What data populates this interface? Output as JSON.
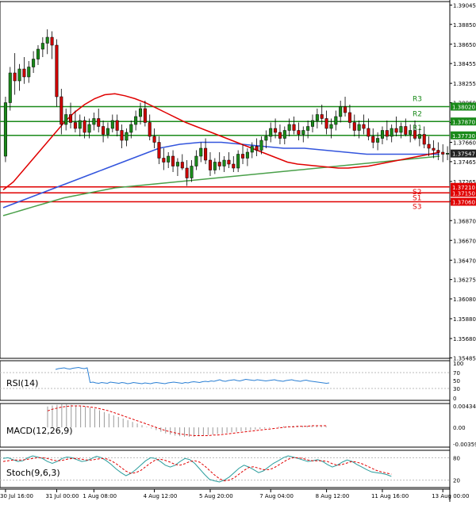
{
  "colors": {
    "up": "#1a8a1a",
    "down": "#cc0000",
    "ma_fast": "#e00000",
    "ma_mid": "#3355dd",
    "ma_slow": "#4aa04a",
    "resistance": "#1a8a1a",
    "support": "#e00000",
    "rsi": "#2a7fd4",
    "macd_hist": "#999999",
    "macd_signal": "#e00000",
    "stoch_main": "#2a9d9d",
    "stoch_signal": "#e00000",
    "price_tag": "#222222"
  },
  "chart_data": [
    {
      "type": "candlestick",
      "ylim": [
        1.3548,
        1.3908
      ],
      "ticks": [
        "1.39045",
        "1.38850",
        "1.38650",
        "1.38455",
        "1.38255",
        "1.38060",
        "1.37860",
        "1.37660",
        "1.37465",
        "1.37265",
        "1.37065",
        "1.36870",
        "1.36670",
        "1.36470",
        "1.36275",
        "1.36080",
        "1.35880",
        "1.35680",
        "1.35485"
      ],
      "current_price": "1.37547",
      "current_value": 1.37547,
      "x_ticks": [
        "30 Jul 16:00",
        "31 Jul 00:00",
        "1 Aug 08:00",
        "4 Aug 12:00",
        "5 Aug 20:00",
        "7 Aug 04:00",
        "8 Aug 12:00",
        "11 Aug 16:00",
        "13 Aug 00:00"
      ],
      "x_tick_index": [
        0,
        11,
        19,
        32,
        44,
        57,
        69,
        81,
        94
      ],
      "levels": [
        {
          "name": "R3",
          "label": "1.38020",
          "value": 1.3802,
          "kind": "resistance"
        },
        {
          "name": "R2",
          "label": "1.37870",
          "value": 1.3787,
          "kind": "resistance"
        },
        {
          "name": "R1",
          "label": "1.37730",
          "value": 1.3773,
          "kind": "resistance"
        },
        {
          "name": "S1",
          "label": "1.37150",
          "value": 1.3715,
          "kind": "support"
        },
        {
          "name": "S2",
          "label": "1.37210",
          "value": 1.3721,
          "kind": "support"
        },
        {
          "name": "S3",
          "label": "1.37060",
          "value": 1.3706,
          "kind": "support"
        }
      ],
      "candles": [
        [
          1.3752,
          1.3812,
          1.3746,
          1.3806
        ],
        [
          1.3806,
          1.3842,
          1.3798,
          1.3836
        ],
        [
          1.3836,
          1.3856,
          1.3814,
          1.3828
        ],
        [
          1.3828,
          1.3845,
          1.3818,
          1.384
        ],
        [
          1.384,
          1.3852,
          1.3825,
          1.3832
        ],
        [
          1.3832,
          1.3848,
          1.3826,
          1.3842
        ],
        [
          1.3842,
          1.3858,
          1.3836,
          1.385
        ],
        [
          1.385,
          1.3864,
          1.3844,
          1.386
        ],
        [
          1.386,
          1.3872,
          1.3852,
          1.3866
        ],
        [
          1.3866,
          1.388,
          1.3855,
          1.3872
        ],
        [
          1.3872,
          1.3878,
          1.385,
          1.3864
        ],
        [
          1.3864,
          1.387,
          1.3802,
          1.3812
        ],
        [
          1.3812,
          1.382,
          1.3774,
          1.3784
        ],
        [
          1.3784,
          1.38,
          1.3778,
          1.3794
        ],
        [
          1.3794,
          1.3806,
          1.378,
          1.3786
        ],
        [
          1.3786,
          1.3798,
          1.3776,
          1.378
        ],
        [
          1.378,
          1.3794,
          1.3772,
          1.3788
        ],
        [
          1.3788,
          1.3792,
          1.377,
          1.3776
        ],
        [
          1.3776,
          1.379,
          1.377,
          1.3784
        ],
        [
          1.3784,
          1.3796,
          1.3778,
          1.379
        ],
        [
          1.379,
          1.38,
          1.3776,
          1.3782
        ],
        [
          1.3782,
          1.3788,
          1.3766,
          1.3774
        ],
        [
          1.3774,
          1.3786,
          1.377,
          1.378
        ],
        [
          1.378,
          1.3794,
          1.3776,
          1.3788
        ],
        [
          1.3788,
          1.3794,
          1.3772,
          1.3778
        ],
        [
          1.3778,
          1.3784,
          1.376,
          1.3768
        ],
        [
          1.3768,
          1.378,
          1.3762,
          1.3776
        ],
        [
          1.3776,
          1.3788,
          1.377,
          1.3784
        ],
        [
          1.3784,
          1.3798,
          1.3778,
          1.3792
        ],
        [
          1.3792,
          1.3806,
          1.3784,
          1.38
        ],
        [
          1.38,
          1.3808,
          1.3782,
          1.3786
        ],
        [
          1.3786,
          1.3794,
          1.3768,
          1.3772
        ],
        [
          1.3772,
          1.378,
          1.376,
          1.3766
        ],
        [
          1.3766,
          1.3772,
          1.3744,
          1.375
        ],
        [
          1.375,
          1.376,
          1.3738,
          1.3746
        ],
        [
          1.3746,
          1.3756,
          1.374,
          1.3752
        ],
        [
          1.3752,
          1.3758,
          1.3736,
          1.3742
        ],
        [
          1.3742,
          1.375,
          1.3732,
          1.3746
        ],
        [
          1.3746,
          1.3754,
          1.3738,
          1.374
        ],
        [
          1.374,
          1.3748,
          1.3722,
          1.373
        ],
        [
          1.373,
          1.3748,
          1.3726,
          1.3742
        ],
        [
          1.3742,
          1.3758,
          1.3738,
          1.3752
        ],
        [
          1.3752,
          1.3766,
          1.3746,
          1.376
        ],
        [
          1.376,
          1.377,
          1.3744,
          1.3748
        ],
        [
          1.3748,
          1.3756,
          1.3732,
          1.3738
        ],
        [
          1.3738,
          1.375,
          1.3734,
          1.3746
        ],
        [
          1.3746,
          1.3756,
          1.3738,
          1.3742
        ],
        [
          1.3742,
          1.3752,
          1.3736,
          1.3748
        ],
        [
          1.3748,
          1.3756,
          1.374,
          1.3744
        ],
        [
          1.3744,
          1.3752,
          1.3736,
          1.374
        ],
        [
          1.374,
          1.3758,
          1.3736,
          1.3754
        ],
        [
          1.3754,
          1.3764,
          1.3744,
          1.375
        ],
        [
          1.375,
          1.376,
          1.3742,
          1.3756
        ],
        [
          1.3756,
          1.3766,
          1.375,
          1.3762
        ],
        [
          1.3762,
          1.377,
          1.3752,
          1.3758
        ],
        [
          1.3758,
          1.3772,
          1.3754,
          1.3768
        ],
        [
          1.3768,
          1.3778,
          1.376,
          1.3772
        ],
        [
          1.3772,
          1.3786,
          1.3766,
          1.378
        ],
        [
          1.378,
          1.379,
          1.377,
          1.3776
        ],
        [
          1.3776,
          1.3784,
          1.3764,
          1.377
        ],
        [
          1.377,
          1.3782,
          1.3764,
          1.3778
        ],
        [
          1.3778,
          1.379,
          1.3772,
          1.3784
        ],
        [
          1.3784,
          1.3792,
          1.3774,
          1.3778
        ],
        [
          1.3778,
          1.3786,
          1.3768,
          1.3774
        ],
        [
          1.3774,
          1.3782,
          1.3766,
          1.3778
        ],
        [
          1.3778,
          1.3788,
          1.377,
          1.3782
        ],
        [
          1.3782,
          1.3794,
          1.3776,
          1.3788
        ],
        [
          1.3788,
          1.38,
          1.378,
          1.3794
        ],
        [
          1.3794,
          1.3804,
          1.3784,
          1.379
        ],
        [
          1.379,
          1.3798,
          1.3774,
          1.378
        ],
        [
          1.378,
          1.379,
          1.377,
          1.3784
        ],
        [
          1.3784,
          1.3798,
          1.3778,
          1.3792
        ],
        [
          1.3792,
          1.3808,
          1.3786,
          1.3802
        ],
        [
          1.3802,
          1.3812,
          1.3792,
          1.3796
        ],
        [
          1.3796,
          1.3804,
          1.378,
          1.3786
        ],
        [
          1.3786,
          1.3794,
          1.3772,
          1.3778
        ],
        [
          1.3778,
          1.3788,
          1.377,
          1.3784
        ],
        [
          1.3784,
          1.3794,
          1.3774,
          1.378
        ],
        [
          1.378,
          1.379,
          1.3768,
          1.3772
        ],
        [
          1.3772,
          1.378,
          1.376,
          1.3766
        ],
        [
          1.3766,
          1.3776,
          1.3758,
          1.377
        ],
        [
          1.377,
          1.3782,
          1.3764,
          1.3778
        ],
        [
          1.3778,
          1.3788,
          1.3768,
          1.3772
        ],
        [
          1.3772,
          1.3784,
          1.3766,
          1.378
        ],
        [
          1.378,
          1.3792,
          1.3772,
          1.3776
        ],
        [
          1.3776,
          1.3786,
          1.377,
          1.3782
        ],
        [
          1.3782,
          1.379,
          1.3772,
          1.3774
        ],
        [
          1.3774,
          1.3784,
          1.3766,
          1.3778
        ],
        [
          1.3778,
          1.3788,
          1.3768,
          1.377
        ],
        [
          1.377,
          1.378,
          1.3762,
          1.3774
        ],
        [
          1.3774,
          1.3782,
          1.376,
          1.3764
        ],
        [
          1.3764,
          1.3772,
          1.3752,
          1.376
        ],
        [
          1.376,
          1.3768,
          1.375,
          1.3758
        ],
        [
          1.3758,
          1.3766,
          1.3748,
          1.3756
        ],
        [
          1.3756,
          1.3764,
          1.3746,
          1.3754
        ],
        [
          1.3754,
          1.3762,
          1.3748,
          1.3755
        ]
      ],
      "ma_fast": [
        1.3718,
        1.3726,
        1.3738,
        1.375,
        1.3762,
        1.3774,
        1.3786,
        1.3796,
        1.3804,
        1.381,
        1.3814,
        1.3815,
        1.3813,
        1.381,
        1.3806,
        1.3801,
        1.3796,
        1.3791,
        1.3786,
        1.3782,
        1.3778,
        1.3774,
        1.377,
        1.3766,
        1.3762,
        1.3758,
        1.3754,
        1.375,
        1.3746,
        1.3744,
        1.3743,
        1.3742,
        1.3741,
        1.374,
        1.374,
        1.3741,
        1.3742,
        1.3744,
        1.3746,
        1.3748,
        1.375,
        1.3752,
        1.3754,
        1.3756
      ],
      "ma_fast_start": 0,
      "ma_mid": [
        1.37,
        1.3704,
        1.3708,
        1.3712,
        1.3716,
        1.372,
        1.3724,
        1.3728,
        1.3732,
        1.3736,
        1.374,
        1.3744,
        1.3748,
        1.3752,
        1.3756,
        1.376,
        1.3762,
        1.3764,
        1.3765,
        1.3766,
        1.3766,
        1.3766,
        1.3765,
        1.3764,
        1.3763,
        1.3762,
        1.3761,
        1.376,
        1.376,
        1.376,
        1.3759,
        1.3758,
        1.3757,
        1.3756,
        1.3755,
        1.3754,
        1.3754,
        1.3754,
        1.3754,
        1.3754,
        1.3754,
        1.3754,
        1.3754
      ],
      "ma_slow": [
        1.3692,
        1.3695,
        1.3698,
        1.3701,
        1.3704,
        1.3707,
        1.371,
        1.3712,
        1.3714,
        1.3716,
        1.3718,
        1.372,
        1.3721,
        1.3722,
        1.3723,
        1.3724,
        1.3725,
        1.3726,
        1.3727,
        1.3728,
        1.3729,
        1.373,
        1.3731,
        1.3732,
        1.3733,
        1.3734,
        1.3735,
        1.3736,
        1.3737,
        1.3738,
        1.3739,
        1.374,
        1.3741,
        1.3742,
        1.3743,
        1.3744,
        1.3745,
        1.3746,
        1.3747,
        1.3748,
        1.3749,
        1.375,
        1.3751,
        1.3752
      ]
    },
    {
      "type": "line",
      "name": "RSI(14)",
      "ylim": [
        0,
        100
      ],
      "ticks": [
        "100",
        "70",
        "50",
        "30",
        "0"
      ],
      "values": [
        78,
        80,
        81,
        82,
        80,
        79,
        81,
        82,
        83,
        81,
        80,
        82,
        45,
        46,
        44,
        43,
        45,
        44,
        43,
        46,
        45,
        44,
        43,
        45,
        44,
        42,
        43,
        45,
        44,
        43,
        42,
        44,
        43,
        42,
        44,
        45,
        44,
        43,
        42,
        44,
        45,
        46,
        45,
        44,
        43,
        45,
        44,
        46,
        47,
        46,
        45,
        47,
        48,
        47,
        49,
        48,
        50,
        52,
        49,
        48,
        50,
        51,
        52,
        50,
        49,
        51,
        53,
        52,
        51,
        50,
        52,
        51,
        50,
        49,
        50,
        51,
        52,
        50,
        49,
        48,
        50,
        51,
        52,
        50,
        49,
        48,
        50,
        51,
        49,
        48,
        47,
        46,
        45,
        44,
        43,
        44
      ]
    },
    {
      "type": "bar",
      "name": "MACD(12,26,9)",
      "ylim": [
        -0.003597,
        0.00434
      ],
      "ticks": [
        "0.00434",
        "0.00",
        "-0.003597"
      ],
      "values": [
        0.0038,
        0.004,
        0.0041,
        0.0042,
        0.0042,
        0.0041,
        0.004,
        0.0039,
        0.0038,
        0.0036,
        0.0034,
        0.0031,
        0.0028,
        0.0025,
        0.0022,
        0.0019,
        0.0016,
        0.0013,
        0.001,
        0.0007,
        0.0004,
        0.0001,
        -0.0002,
        -0.0005,
        -0.0008,
        -0.0011,
        -0.0013,
        -0.0015,
        -0.0016,
        -0.0017,
        -0.0017,
        -0.0017,
        -0.0016,
        -0.0015,
        -0.0014,
        -0.0013,
        -0.0012,
        -0.0011,
        -0.001,
        -0.0009,
        -0.0008,
        -0.0007,
        -0.0006,
        -0.0005,
        -0.0004,
        -0.0003,
        -0.0002,
        -0.0001,
        0.0,
        0.0001,
        0.0002,
        0.0002,
        0.0003,
        0.0003,
        0.0003,
        0.0003,
        0.0003,
        0.0002,
        0.0002,
        0.0002
      ],
      "signal": [
        0.003,
        0.0033,
        0.0035,
        0.0037,
        0.0038,
        0.0039,
        0.0039,
        0.0039,
        0.0038,
        0.0037,
        0.0036,
        0.0034,
        0.0032,
        0.003,
        0.0027,
        0.0024,
        0.0021,
        0.0018,
        0.0015,
        0.0012,
        0.0009,
        0.0006,
        0.0003,
        0.0,
        -0.0003,
        -0.0006,
        -0.0008,
        -0.001,
        -0.0012,
        -0.0013,
        -0.0014,
        -0.0015,
        -0.0015,
        -0.0015,
        -0.0015,
        -0.0014,
        -0.0014,
        -0.0013,
        -0.0012,
        -0.0011,
        -0.001,
        -0.0009,
        -0.0008,
        -0.0007,
        -0.0006,
        -0.0005,
        -0.0004,
        -0.0003,
        -0.0002,
        -0.0001,
        0.0,
        0.0001,
        0.0001,
        0.0002,
        0.0002,
        0.0002,
        0.0003,
        0.0003,
        0.0003,
        0.0003
      ]
    },
    {
      "type": "line",
      "name": "Stoch(9,6,3)",
      "ylim": [
        0,
        100
      ],
      "ticks": [
        "80",
        "20"
      ],
      "values": [
        78,
        80,
        75,
        70,
        72,
        80,
        85,
        82,
        78,
        70,
        65,
        70,
        78,
        82,
        80,
        75,
        70,
        72,
        78,
        84,
        80,
        72,
        62,
        50,
        40,
        32,
        38,
        48,
        60,
        72,
        80,
        78,
        70,
        60,
        55,
        60,
        70,
        78,
        75,
        65,
        50,
        35,
        22,
        18,
        15,
        20,
        28,
        40,
        52,
        60,
        55,
        48,
        40,
        45,
        55,
        65,
        72,
        80,
        85,
        82,
        78,
        74,
        70,
        72,
        75,
        70,
        62,
        55,
        60,
        68,
        74,
        70,
        62,
        55,
        48,
        42,
        40,
        38,
        35,
        30
      ],
      "signal": [
        70,
        72,
        74,
        74,
        74,
        76,
        78,
        80,
        80,
        78,
        74,
        72,
        73,
        76,
        78,
        78,
        76,
        74,
        74,
        76,
        78,
        77,
        72,
        64,
        54,
        44,
        38,
        40,
        46,
        56,
        66,
        74,
        76,
        73,
        68,
        62,
        60,
        64,
        70,
        72,
        68,
        58,
        46,
        34,
        24,
        18,
        20,
        26,
        36,
        46,
        54,
        56,
        52,
        48,
        48,
        52,
        60,
        68,
        76,
        80,
        80,
        78,
        74,
        72,
        72,
        72,
        70,
        64,
        60,
        62,
        66,
        70,
        68,
        64,
        58,
        52,
        46,
        42,
        39,
        36
      ]
    }
  ]
}
